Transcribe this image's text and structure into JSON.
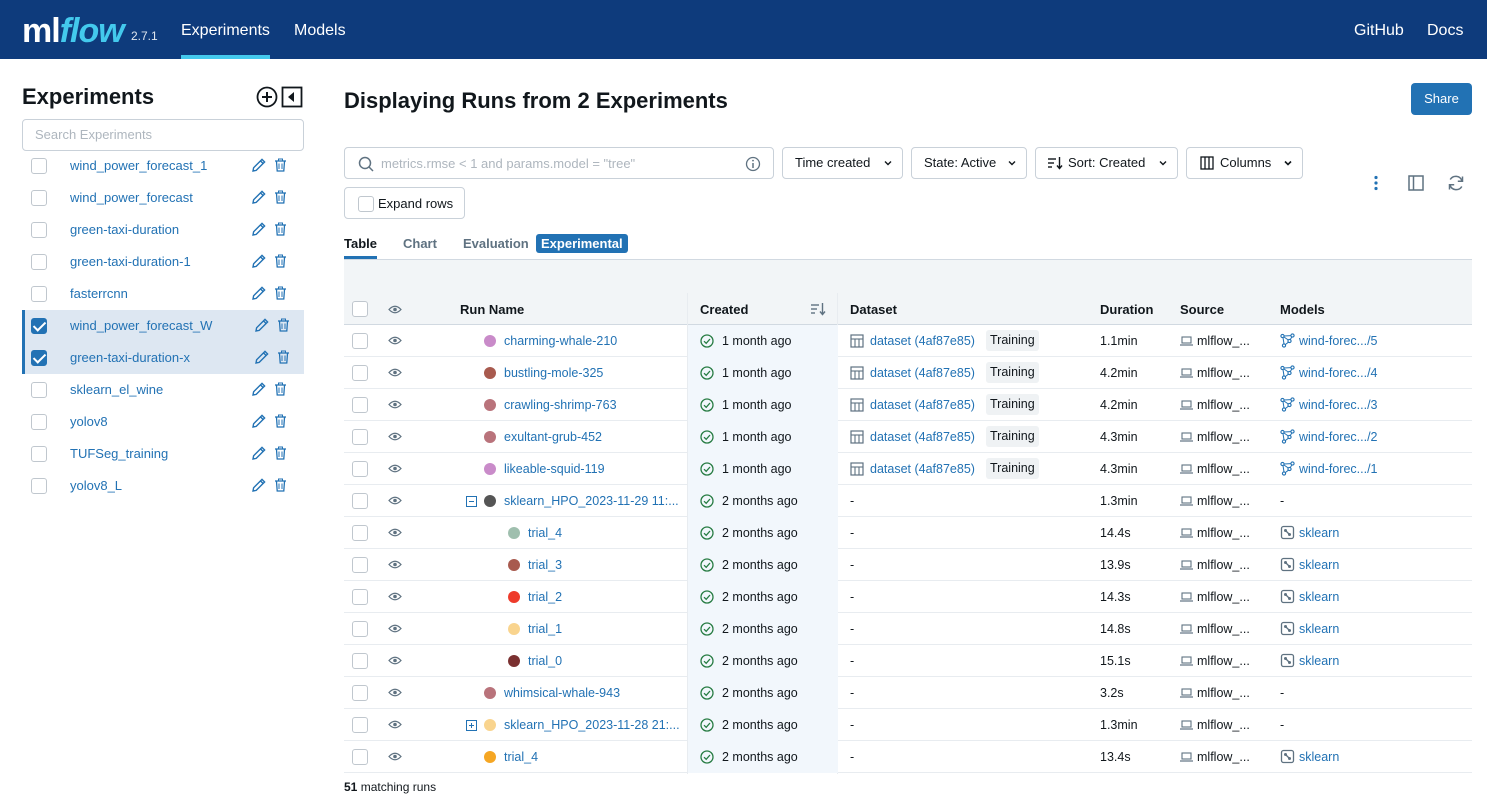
{
  "header": {
    "logo_ml": "ml",
    "logo_flow": "flow",
    "version": "2.7.1",
    "nav": [
      {
        "label": "Experiments",
        "active": true
      },
      {
        "label": "Models",
        "active": false
      }
    ],
    "right_links": [
      "GitHub",
      "Docs"
    ],
    "bg_color": "#0e3b7c",
    "accent_color": "#43c9ed"
  },
  "sidebar": {
    "title": "Experiments",
    "add_icon": "plus-circle-icon",
    "collapse_icon": "collapse-sidebar-icon",
    "search_placeholder": "Search Experiments",
    "experiments": [
      {
        "name": "wind_power_forecast_1",
        "checked": false
      },
      {
        "name": "wind_power_forecast",
        "checked": false
      },
      {
        "name": "green-taxi-duration",
        "checked": false
      },
      {
        "name": "green-taxi-duration-1",
        "checked": false
      },
      {
        "name": "fasterrcnn",
        "checked": false
      },
      {
        "name": "wind_power_forecast_W",
        "checked": true
      },
      {
        "name": "green-taxi-duration-x",
        "checked": true
      },
      {
        "name": "sklearn_el_wine",
        "checked": false
      },
      {
        "name": "yolov8",
        "checked": false
      },
      {
        "name": "TUFSeg_training",
        "checked": false
      },
      {
        "name": "yolov8_L",
        "checked": false
      }
    ]
  },
  "main": {
    "title": "Displaying Runs from 2 Experiments",
    "share_label": "Share",
    "search_placeholder": "metrics.rmse < 1 and params.model = \"tree\"",
    "filters": {
      "time_created": "Time created",
      "state": "State: Active",
      "sort": "Sort: Created",
      "columns": "Columns"
    },
    "expand_rows": "Expand rows",
    "tabs": [
      {
        "label": "Table",
        "active": true
      },
      {
        "label": "Chart",
        "active": false
      },
      {
        "label": "Evaluation",
        "active": false
      }
    ],
    "experimental_badge": "Experimental",
    "columns": {
      "run_name": "Run Name",
      "created": "Created",
      "dataset": "Dataset",
      "duration": "Duration",
      "source": "Source",
      "models": "Models"
    },
    "runs": [
      {
        "name": "charming-whale-210",
        "color": "#c98bc9",
        "indent": 0,
        "expander": "",
        "created": "1 month ago",
        "dataset": "dataset (4af87e85)",
        "dataset_tag": "Training",
        "duration": "1.1min",
        "source": "mlflow_...",
        "model": "wind-forec.../5",
        "model_type": "registered"
      },
      {
        "name": "bustling-mole-325",
        "color": "#a85a4e",
        "indent": 0,
        "expander": "",
        "created": "1 month ago",
        "dataset": "dataset (4af87e85)",
        "dataset_tag": "Training",
        "duration": "4.2min",
        "source": "mlflow_...",
        "model": "wind-forec.../4",
        "model_type": "registered"
      },
      {
        "name": "crawling-shrimp-763",
        "color": "#b9737b",
        "indent": 0,
        "expander": "",
        "created": "1 month ago",
        "dataset": "dataset (4af87e85)",
        "dataset_tag": "Training",
        "duration": "4.2min",
        "source": "mlflow_...",
        "model": "wind-forec.../3",
        "model_type": "registered"
      },
      {
        "name": "exultant-grub-452",
        "color": "#b9737b",
        "indent": 0,
        "expander": "",
        "created": "1 month ago",
        "dataset": "dataset (4af87e85)",
        "dataset_tag": "Training",
        "duration": "4.3min",
        "source": "mlflow_...",
        "model": "wind-forec.../2",
        "model_type": "registered"
      },
      {
        "name": "likeable-squid-119",
        "color": "#c98bc9",
        "indent": 0,
        "expander": "",
        "created": "1 month ago",
        "dataset": "dataset (4af87e85)",
        "dataset_tag": "Training",
        "duration": "4.3min",
        "source": "mlflow_...",
        "model": "wind-forec.../1",
        "model_type": "registered"
      },
      {
        "name": "sklearn_HPO_2023-11-29 11:...",
        "color": "#555555",
        "indent": 0,
        "expander": "minus",
        "created": "2 months ago",
        "dataset": "-",
        "dataset_tag": "",
        "duration": "1.3min",
        "source": "mlflow_...",
        "model": "-",
        "model_type": "none"
      },
      {
        "name": "trial_4",
        "color": "#9fbfae",
        "indent": 1,
        "expander": "",
        "created": "2 months ago",
        "dataset": "-",
        "dataset_tag": "",
        "duration": "14.4s",
        "source": "mlflow_...",
        "model": "sklearn",
        "model_type": "logged"
      },
      {
        "name": "trial_3",
        "color": "#a85a4e",
        "indent": 1,
        "expander": "",
        "created": "2 months ago",
        "dataset": "-",
        "dataset_tag": "",
        "duration": "13.9s",
        "source": "mlflow_...",
        "model": "sklearn",
        "model_type": "logged"
      },
      {
        "name": "trial_2",
        "color": "#ee3b2b",
        "indent": 1,
        "expander": "",
        "created": "2 months ago",
        "dataset": "-",
        "dataset_tag": "",
        "duration": "14.3s",
        "source": "mlflow_...",
        "model": "sklearn",
        "model_type": "logged"
      },
      {
        "name": "trial_1",
        "color": "#f9d48e",
        "indent": 1,
        "expander": "",
        "created": "2 months ago",
        "dataset": "-",
        "dataset_tag": "",
        "duration": "14.8s",
        "source": "mlflow_...",
        "model": "sklearn",
        "model_type": "logged"
      },
      {
        "name": "trial_0",
        "color": "#7a3030",
        "indent": 1,
        "expander": "",
        "created": "2 months ago",
        "dataset": "-",
        "dataset_tag": "",
        "duration": "15.1s",
        "source": "mlflow_...",
        "model": "sklearn",
        "model_type": "logged"
      },
      {
        "name": "whimsical-whale-943",
        "color": "#b9737b",
        "indent": 0,
        "expander": "",
        "created": "2 months ago",
        "dataset": "-",
        "dataset_tag": "",
        "duration": "3.2s",
        "source": "mlflow_...",
        "model": "-",
        "model_type": "none"
      },
      {
        "name": "sklearn_HPO_2023-11-28 21:...",
        "color": "#f9d48e",
        "indent": 0,
        "expander": "plus",
        "created": "2 months ago",
        "dataset": "-",
        "dataset_tag": "",
        "duration": "1.3min",
        "source": "mlflow_...",
        "model": "-",
        "model_type": "none"
      },
      {
        "name": "trial_4",
        "color": "#f5a623",
        "indent": 0,
        "expander": "",
        "created": "2 months ago",
        "dataset": "-",
        "dataset_tag": "",
        "duration": "13.4s",
        "source": "mlflow_...",
        "model": "sklearn",
        "model_type": "logged"
      }
    ],
    "footer_count": "51",
    "footer_text": "matching runs"
  }
}
